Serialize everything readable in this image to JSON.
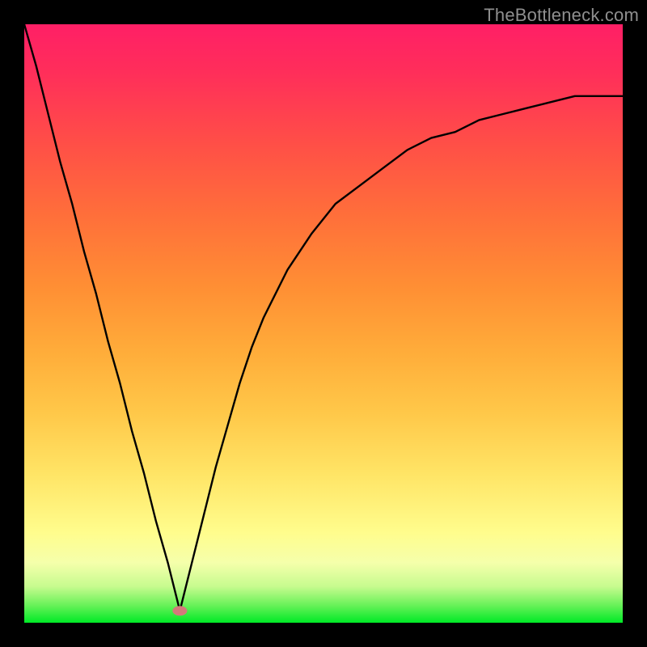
{
  "watermark": "TheBottleneck.com",
  "chart_data": {
    "type": "line",
    "title": "",
    "xlabel": "",
    "ylabel": "",
    "xlim": [
      0,
      100
    ],
    "ylim": [
      0,
      100
    ],
    "grid": false,
    "legend": false,
    "dip_marker": {
      "x": 26,
      "y": 98,
      "color": "#d47a7a"
    },
    "series": [
      {
        "name": "bottleneck-curve",
        "color": "#000000",
        "x": [
          0,
          2,
          4,
          6,
          8,
          10,
          12,
          14,
          16,
          18,
          20,
          22,
          24,
          25,
          26,
          27,
          28,
          30,
          32,
          34,
          36,
          38,
          40,
          44,
          48,
          52,
          56,
          60,
          64,
          68,
          72,
          76,
          80,
          84,
          88,
          92,
          96,
          100
        ],
        "y": [
          0,
          7,
          15,
          23,
          30,
          38,
          45,
          53,
          60,
          68,
          75,
          83,
          90,
          94,
          98,
          94,
          90,
          82,
          74,
          67,
          60,
          54,
          49,
          41,
          35,
          30,
          27,
          24,
          21,
          19,
          18,
          16,
          15,
          14,
          13,
          12,
          12,
          12
        ]
      }
    ]
  }
}
